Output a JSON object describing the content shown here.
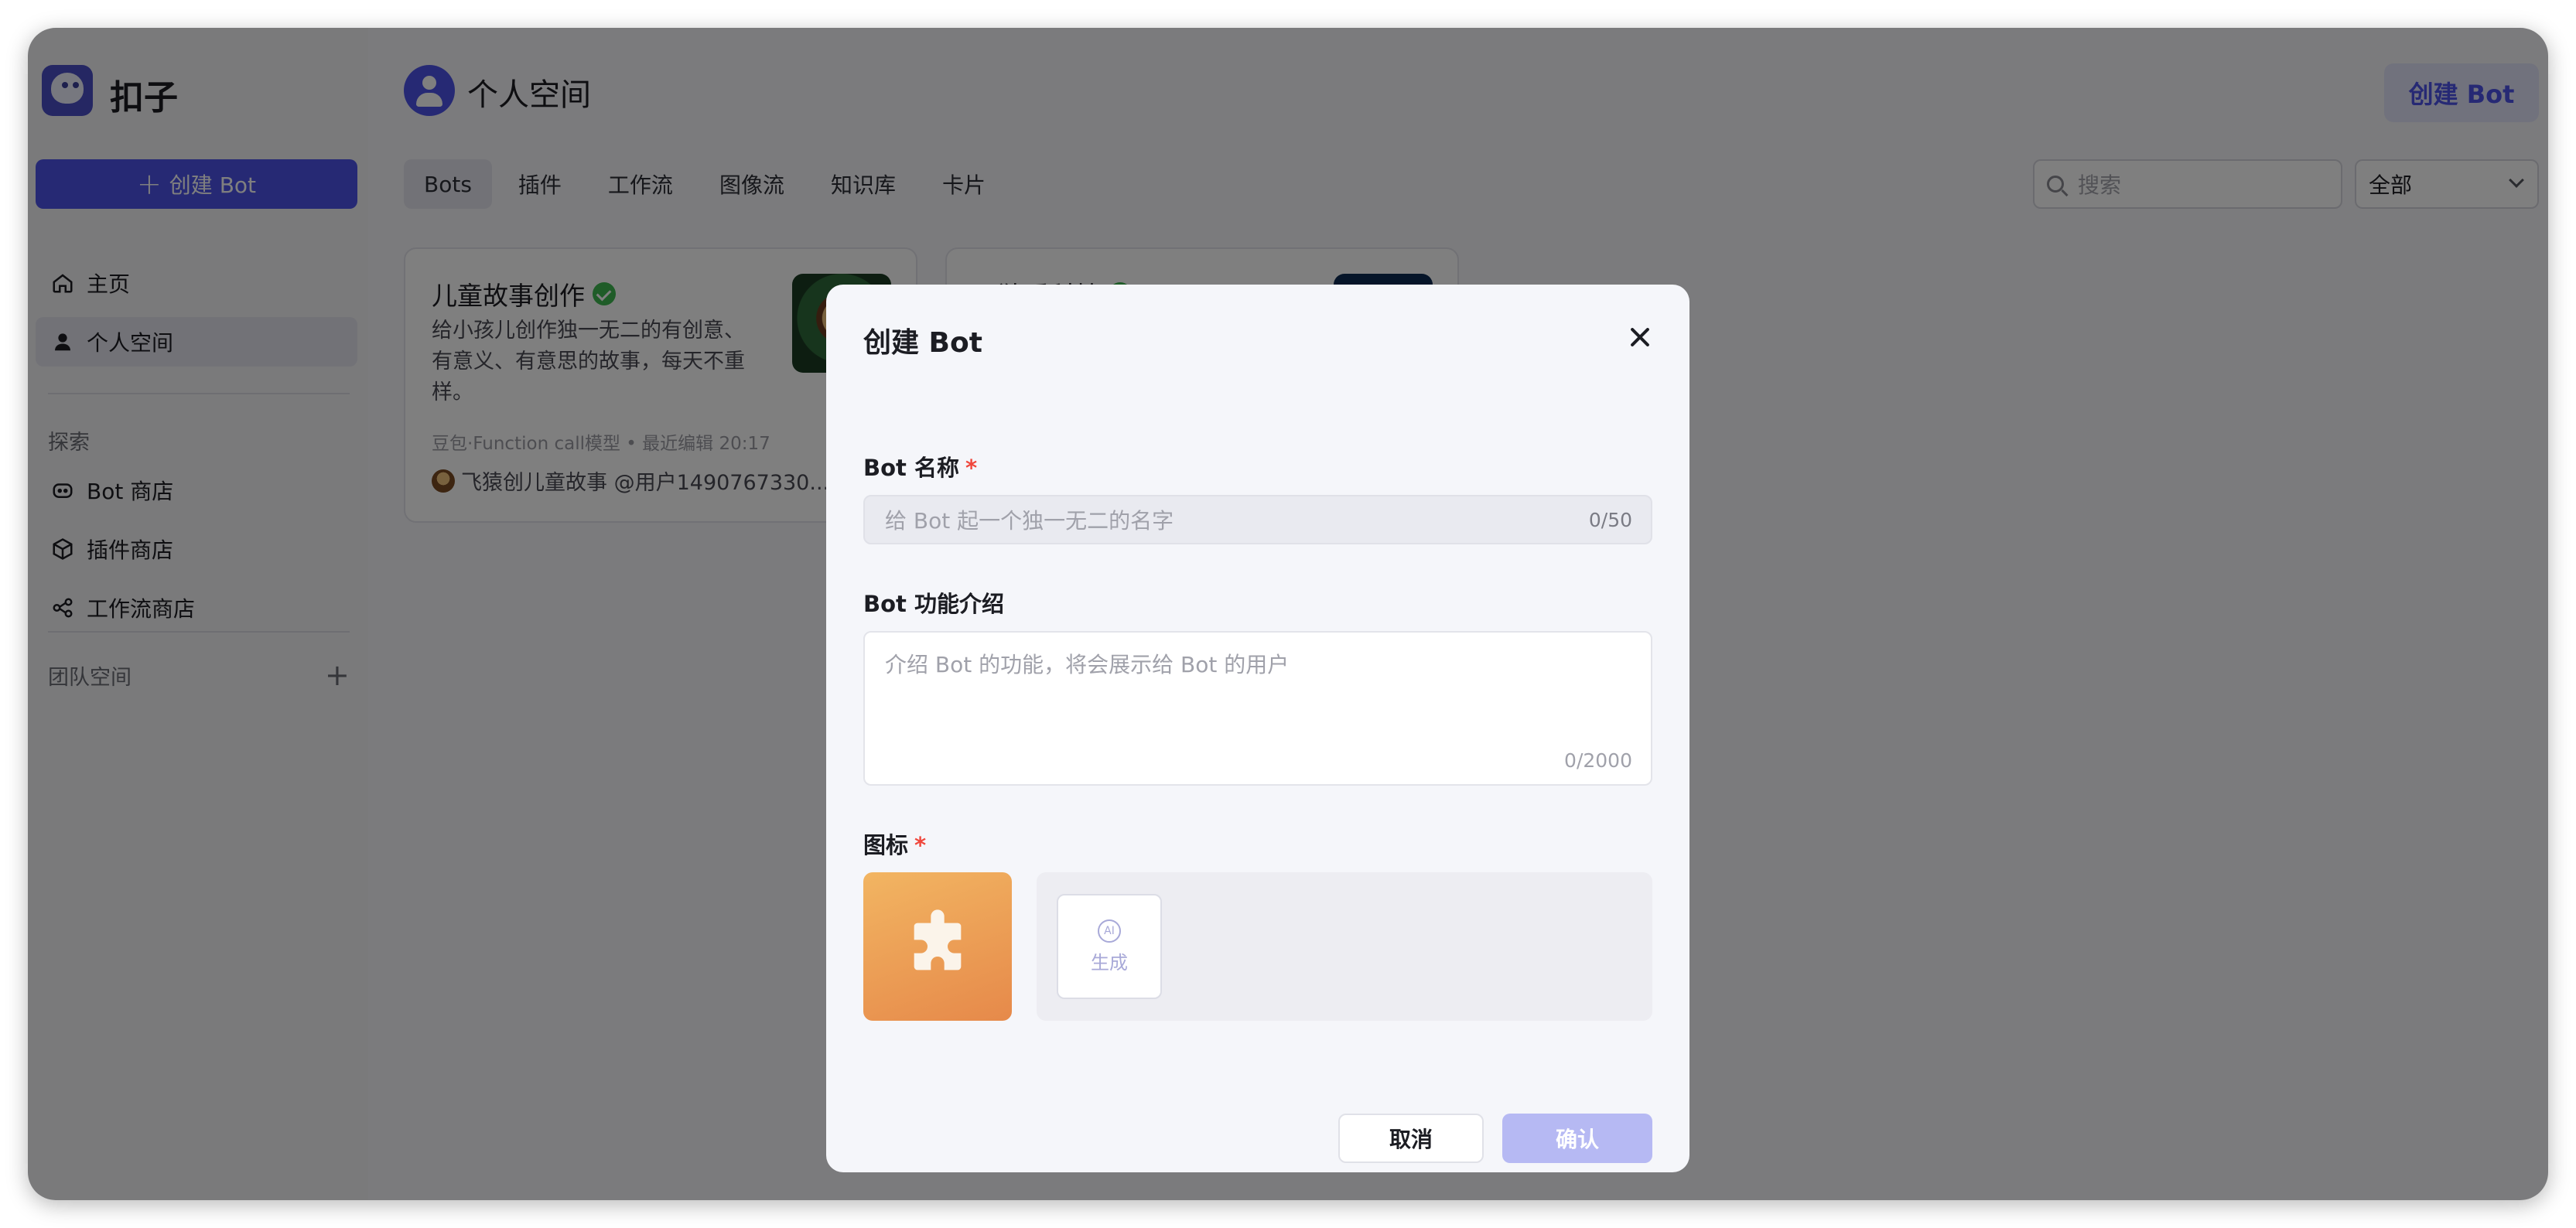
{
  "app": {
    "brand": "扣子"
  },
  "sidebar": {
    "create_label": "创建 Bot",
    "items": [
      {
        "label": "主页",
        "icon": "home-icon"
      },
      {
        "label": "个人空间",
        "icon": "user-icon",
        "active": true
      }
    ],
    "explore_title": "探索",
    "explore_items": [
      {
        "label": "Bot 商店",
        "icon": "bot-icon"
      },
      {
        "label": "插件商店",
        "icon": "cube-icon"
      },
      {
        "label": "工作流商店",
        "icon": "workflow-icon"
      }
    ],
    "team_title": "团队空间"
  },
  "header": {
    "title": "个人空间",
    "create_label": "创建 Bot"
  },
  "tabs": [
    "Bots",
    "插件",
    "工作流",
    "图像流",
    "知识库",
    "卡片"
  ],
  "search": {
    "placeholder": "搜索"
  },
  "filter": {
    "value": "全部"
  },
  "cards": [
    {
      "title": "儿童故事创作",
      "desc": "给小孩儿创作独一无二的有创意、有意义、有意思的故事，每天不重样。",
      "meta": "豆包·Function call模型 • 最近编辑 20:17",
      "author": "飞猿创儿童故事 @用户1490767330..."
    },
    {
      "title": "飞猿爱科技"
    }
  ],
  "modal": {
    "title": "创建 Bot",
    "name_label": "Bot 名称",
    "name_placeholder": "给 Bot 起一个独一无二的名字",
    "name_count": "0/50",
    "desc_label": "Bot 功能介绍",
    "desc_placeholder": "介绍 Bot 的功能，将会展示给 Bot 的用户",
    "desc_count": "0/2000",
    "icon_label": "图标",
    "required_mark": "*",
    "ai_label": "AI",
    "generate_label": "生成",
    "cancel_label": "取消",
    "confirm_label": "确认"
  },
  "colors": {
    "accent": "#4d53e8",
    "required": "#f0473c",
    "verified": "#3fb950"
  }
}
